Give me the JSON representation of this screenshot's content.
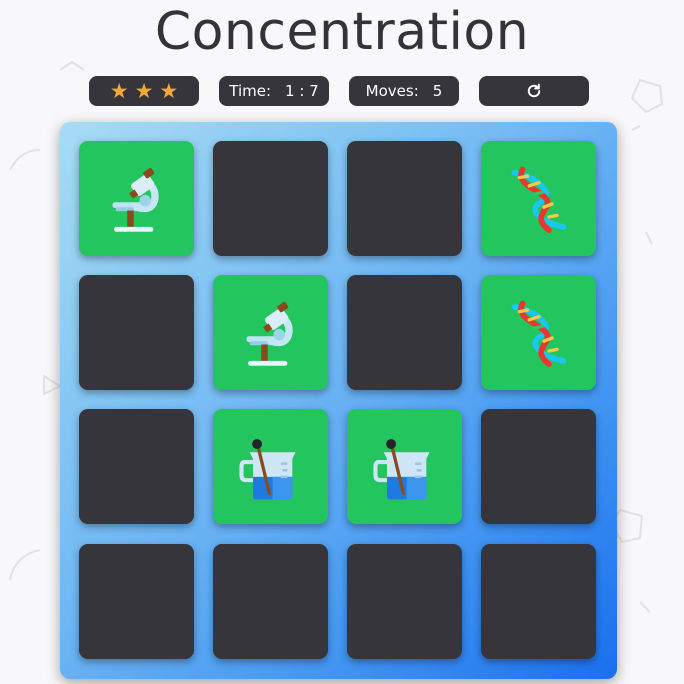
{
  "app": {
    "title": "Concentration"
  },
  "score_panel": {
    "stars": {
      "rating": 3,
      "max": 3,
      "glyph": "★",
      "color": "#f2a93b",
      "icon": "star-icon"
    },
    "time": {
      "label": "Time:",
      "value": "1 : 7"
    },
    "moves": {
      "label": "Moves:",
      "value": "5"
    },
    "restart": {
      "icon": "restart-icon",
      "glyph": "↻"
    }
  },
  "board": {
    "rows": 4,
    "cols": 4,
    "cards": [
      {
        "state": "up",
        "icon": "microscope-icon"
      },
      {
        "state": "down"
      },
      {
        "state": "down"
      },
      {
        "state": "up",
        "icon": "dna-icon"
      },
      {
        "state": "down"
      },
      {
        "state": "up",
        "icon": "microscope-icon"
      },
      {
        "state": "down"
      },
      {
        "state": "up",
        "icon": "dna-icon"
      },
      {
        "state": "down"
      },
      {
        "state": "up",
        "icon": "beaker-icon"
      },
      {
        "state": "up",
        "icon": "beaker-icon"
      },
      {
        "state": "down"
      },
      {
        "state": "down"
      },
      {
        "state": "down"
      },
      {
        "state": "down"
      },
      {
        "state": "down"
      }
    ],
    "colors": {
      "face_down": "#35353b",
      "face_up": "#22c55e"
    }
  }
}
